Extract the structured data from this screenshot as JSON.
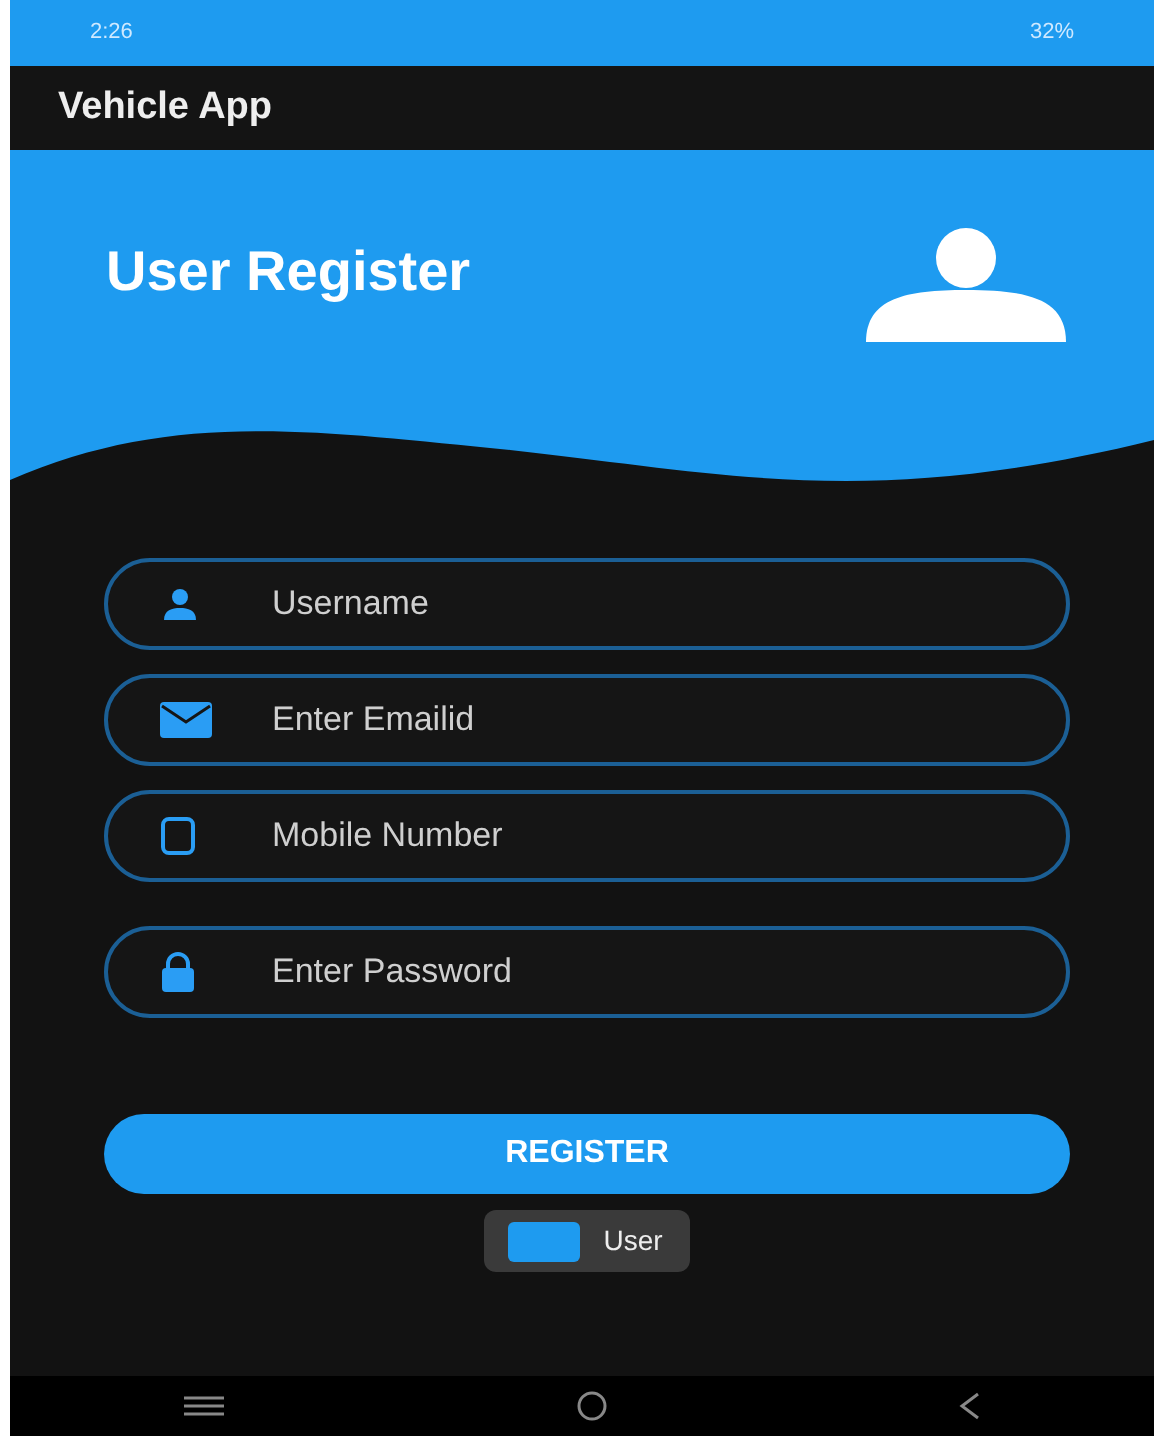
{
  "status_bar": {
    "time": "2:26",
    "battery": "32%"
  },
  "app_bar": {
    "title": "Vehicle App"
  },
  "header": {
    "title": "User Register"
  },
  "fields": [
    {
      "kind": "user",
      "placeholder": "Username"
    },
    {
      "kind": "email",
      "placeholder": "Enter Emailid"
    },
    {
      "kind": "phone",
      "placeholder": "Mobile Number"
    },
    {
      "kind": "lock",
      "placeholder": "Enter Password"
    }
  ],
  "register_button": {
    "label": "REGISTER"
  },
  "role_chip": {
    "label": "User"
  }
}
